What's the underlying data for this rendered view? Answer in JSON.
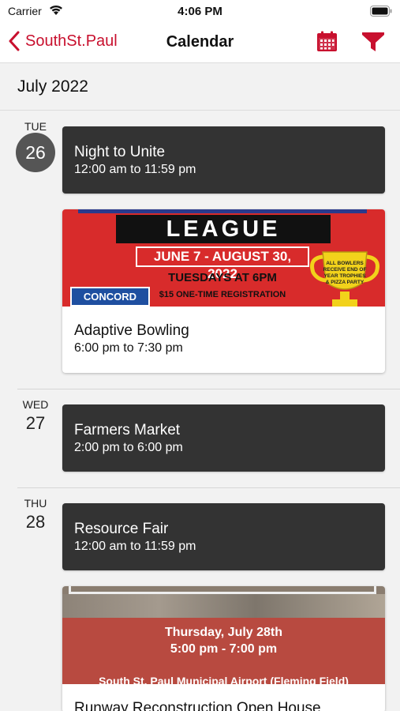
{
  "status_bar": {
    "carrier": "Carrier",
    "time": "4:06 PM"
  },
  "nav": {
    "back_label": "SouthSt.Paul",
    "title": "Calendar"
  },
  "month": "July 2022",
  "days": [
    {
      "weekday": "TUE",
      "day": "26",
      "events": [
        {
          "title": "Night to Unite",
          "time": "12:00 am to 11:59 pm"
        },
        {
          "title": "Adaptive Bowling",
          "time": "6:00 pm to 7:30 pm",
          "image": {
            "heading": "LEAGUE",
            "dates": "JUNE 7 - AUGUST 30, 2022",
            "schedule": "TUESDAYS AT 6PM",
            "registration": "$15 ONE-TIME REGISTRATION",
            "venue": "CONCORD LANES",
            "trophy_text": "ALL BOWLERS RECEIVE END OF YEAR TROPHIES & PIZZA PARTY"
          }
        }
      ]
    },
    {
      "weekday": "WED",
      "day": "27",
      "events": [
        {
          "title": "Farmers Market",
          "time": "2:00 pm to 6:00 pm"
        }
      ]
    },
    {
      "weekday": "THU",
      "day": "28",
      "events": [
        {
          "title": "Resource Fair",
          "time": "12:00 am to 11:59 pm"
        },
        {
          "title": "Runway Reconstruction Open House",
          "image": {
            "date": "Thursday, July 28th",
            "hours": "5:00 pm - 7:00 pm",
            "place": "South St. Paul Municipal Airport (Fleming Field)"
          }
        }
      ]
    }
  ],
  "colors": {
    "accent": "#c8102e",
    "card": "#333333",
    "today": "#555555"
  },
  "icons": {
    "back": "chevron-left-icon",
    "calendar": "calendar-icon",
    "filter": "filter-icon",
    "wifi": "wifi-icon",
    "battery": "battery-icon"
  }
}
